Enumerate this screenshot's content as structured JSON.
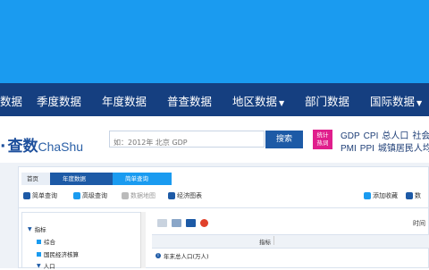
{
  "nav": {
    "items": [
      {
        "label": "数据",
        "has_arrow": false
      },
      {
        "label": "季度数据",
        "has_arrow": false
      },
      {
        "label": "年度数据",
        "has_arrow": false
      },
      {
        "label": "普查数据",
        "has_arrow": false
      },
      {
        "label": "地区数据",
        "has_arrow": true
      },
      {
        "label": "部门数据",
        "has_arrow": false
      },
      {
        "label": "国际数据",
        "has_arrow": true
      }
    ]
  },
  "brand": {
    "logo_cn": "查数",
    "logo_en": "ChaShu"
  },
  "search": {
    "placeholder": "如：2012年 北京 GDP",
    "button_label": "搜索"
  },
  "hot": {
    "badge_line1": "统计",
    "badge_line2": "热词",
    "line1": [
      "GDP",
      "CPI",
      "总人口",
      "社会"
    ],
    "line2": [
      "PMI",
      "PPI",
      "城镇居民人均"
    ]
  },
  "breadcrumb": {
    "home": "首页",
    "level1": "年度数据",
    "current": "简单查询"
  },
  "toolbar": {
    "simple_query": "简单查询",
    "advanced_query": "高级查询",
    "data_map": "数据地图",
    "economic_chart": "经济图表",
    "add_favorite": "添加收藏",
    "data_more": "数"
  },
  "tree": {
    "root": "指标",
    "items": [
      "综合",
      "国民经济核算",
      "人口"
    ]
  },
  "table": {
    "time_header": "时间",
    "indicator_header": "指标",
    "rows": [
      "年末总人口(万人)"
    ]
  },
  "colors": {
    "banner": "#1a9bf0",
    "nav_bg": "#153f80",
    "search_button": "#1d5aa6",
    "hot_badge": "#e01e8c"
  }
}
